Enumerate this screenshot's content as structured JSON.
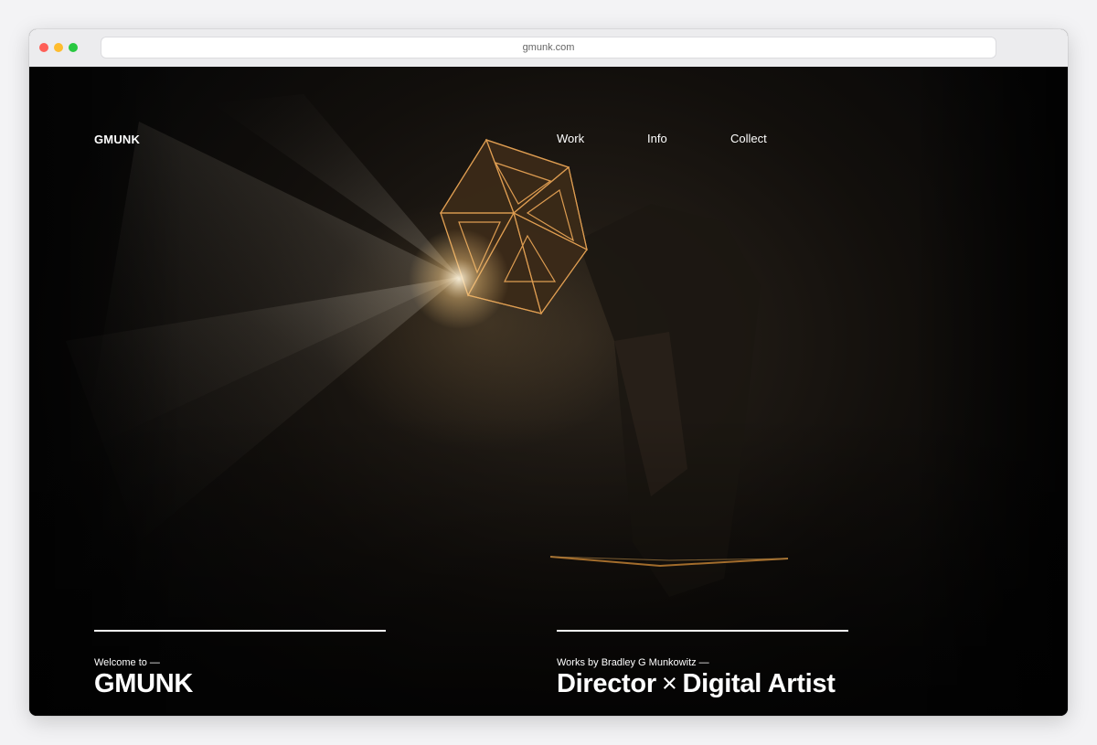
{
  "browser": {
    "url": "gmunk.com",
    "traffic_lights": {
      "close": "#fe5f57",
      "minimize": "#febc2e",
      "maximize": "#28c840"
    }
  },
  "site": {
    "logo": "GMUNK",
    "nav": [
      {
        "label": "Work"
      },
      {
        "label": "Info"
      },
      {
        "label": "Collect"
      }
    ],
    "intro_left": {
      "kicker": "Welcome to —",
      "title": "GMUNK"
    },
    "intro_right": {
      "kicker": "Works by Bradley G Munkowitz —",
      "title_part1": "Director",
      "separator": "×",
      "title_part2": "Digital Artist"
    },
    "colors": {
      "text": "#ffffff",
      "background": "#0b0a09",
      "accent_glow": "#f0a040"
    }
  }
}
